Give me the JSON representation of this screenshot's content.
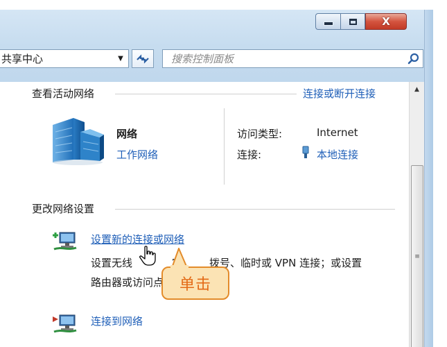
{
  "window": {
    "caption_buttons": [
      "minimize",
      "maximize",
      "close"
    ],
    "close_symbol": "X"
  },
  "address": {
    "breadcrumb": "共享中心",
    "search_placeholder": "搜索控制面板"
  },
  "active_networks": {
    "title": "查看活动网络",
    "connect_link": "连接或断开连接",
    "network_name": "网络",
    "network_type": "工作网络",
    "access_type_label": "访问类型:",
    "access_type_value": "Internet",
    "connection_label": "连接:",
    "connection_value": "本地连接"
  },
  "change_settings": {
    "title": "更改网络设置",
    "items": [
      {
        "link": "设置新的连接或网络",
        "desc_line1_left": "设置无线",
        "desc_line1_mid": "宽",
        "desc_line1_right": "拨号、临时或 VPN 连接；或设置",
        "desc_line2": "路由器或访问点。"
      },
      {
        "link": "连接到网络"
      }
    ]
  },
  "callout": {
    "text": "单击"
  },
  "colors": {
    "link": "#1f5fb8",
    "callout_fill": "#fbe3b4",
    "callout_border": "#e38b2a",
    "callout_text": "#e36a16"
  },
  "icons": [
    "minimize-icon",
    "maximize-icon",
    "close-icon",
    "dropdown-arrow-icon",
    "refresh-icon",
    "search-icon",
    "network-building-icon",
    "ethernet-plug-icon",
    "network-setup-icon",
    "connect-network-icon",
    "hand-cursor-icon",
    "scroll-up-icon",
    "scroll-grip-icon"
  ]
}
